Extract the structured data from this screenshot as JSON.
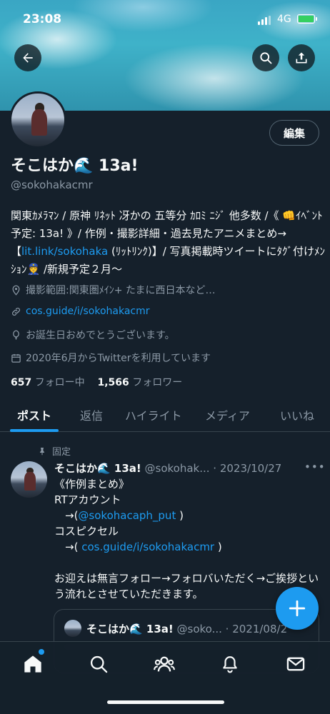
{
  "status_bar": {
    "time": "23:08",
    "network": "4G"
  },
  "header": {
    "back_icon": "arrow-left-icon",
    "search_icon": "search-icon",
    "share_icon": "share-icon"
  },
  "profile": {
    "edit_label": "編集",
    "display_name": "そこはか🌊 13a!",
    "handle": "@sokohakacmr",
    "bio_part1": "関東ｶﾒﾗﾏﾝ / 原神 ﾘﾈｯﾄ 冴かの 五等分 ｶﾛﾐ ﾆｼﾞ 他多数 /《 👊ｲﾍﾞﾝﾄ予定: 13a! 》/ 作例・撮影詳細・過去見たアニメまとめ→【",
    "bio_link": "lit.link/sokohaka",
    "bio_part2": " (ﾘｯﾄﾘﾝｸ)】/ 写真掲載時ツイートにﾀｸﾞ付けﾒﾝｼｮﾝ👮 /新規予定２月〜",
    "location": "撮影範囲:関東圏ﾒｲﾝ+ たまに西日本など…",
    "website": "cos.guide/i/sokohakacmr",
    "birthday": "お誕生日おめでとうございます。",
    "joined": "2020年6月からTwitterを利用しています",
    "following_count": "657",
    "following_label": "フォロー中",
    "followers_count": "1,566",
    "followers_label": "フォロワー"
  },
  "tabs": [
    {
      "label": "ポスト",
      "active": true
    },
    {
      "label": "返信",
      "active": false
    },
    {
      "label": "ハイライト",
      "active": false
    },
    {
      "label": "メディア",
      "active": false
    },
    {
      "label": "いいね",
      "active": false
    }
  ],
  "pinned_tweet": {
    "pinned_label": "固定",
    "name": "そこはか🌊 13a!",
    "handle_date": "@sokohak... · 2023/10/27",
    "more": "•••",
    "line1": "《作例まとめ》",
    "line2": "RTアカウント",
    "line3_pre": "　→(",
    "line3_link": "@sokohacaph_put",
    "line3_post": " )",
    "line4": "コスピクセル",
    "line5_pre": "　→( ",
    "line5_link": "cos.guide/i/sokohakacmr",
    "line5_post": " )",
    "line6": "お迎えは無言フォロー→フォロバいただく→ご挨拶という流れとさせていただきます。",
    "quote_name": "そこはか🌊 13a!",
    "quote_meta": "@soko... · 2021/08/2"
  },
  "nav": {
    "home_icon": "home-icon",
    "search_icon": "search-icon",
    "communities_icon": "people-icon",
    "notifications_icon": "bell-icon",
    "messages_icon": "mail-icon"
  },
  "colors": {
    "background": "#15202b",
    "accent": "#1d9bf0",
    "muted": "#8b98a5"
  }
}
